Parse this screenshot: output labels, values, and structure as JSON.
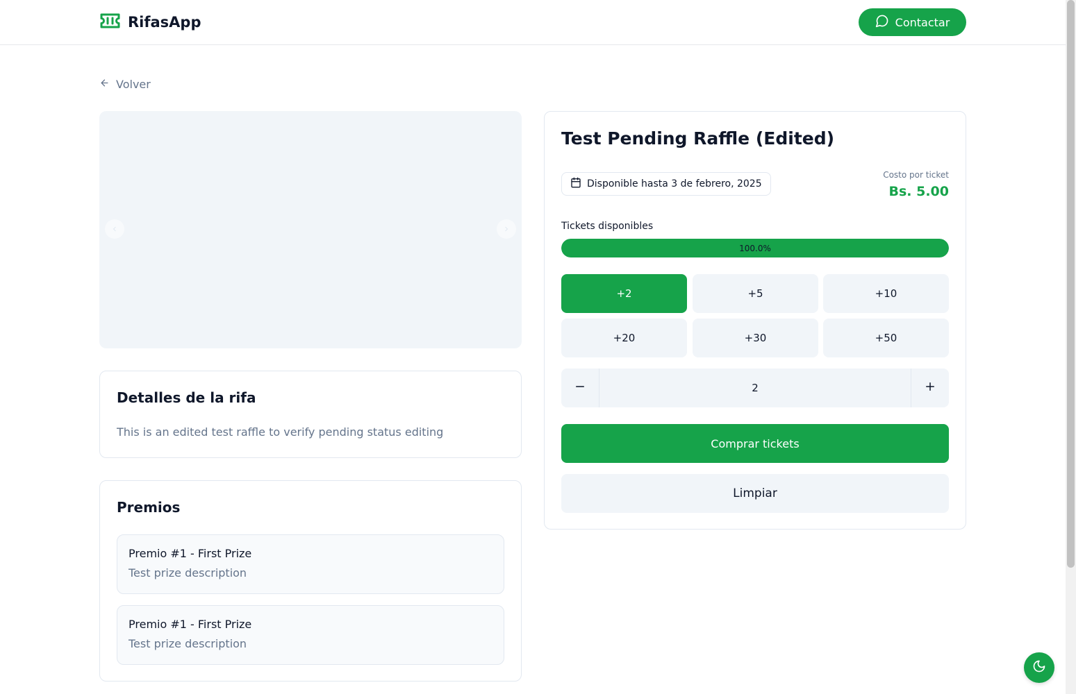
{
  "header": {
    "brand": "RifasApp",
    "brand_icon": "ticket-icon",
    "contact_label": "Contactar",
    "contact_icon": "message-circle-icon",
    "accent_color": "#16a34a"
  },
  "nav": {
    "back_label": "Volver",
    "back_icon": "arrow-left-icon"
  },
  "carousel": {
    "prev_icon": "chevron-left-icon",
    "next_icon": "chevron-right-icon"
  },
  "details": {
    "title": "Detalles de la rifa",
    "description": "This is an edited test raffle to verify pending status editing"
  },
  "prizes": {
    "title": "Premios",
    "items": [
      {
        "name": "Premio #1 - First Prize",
        "description": "Test prize description"
      },
      {
        "name": "Premio #1 - First Prize",
        "description": "Test prize description"
      }
    ]
  },
  "raffle": {
    "title": "Test Pending Raffle (Edited)",
    "available_until": "Disponible hasta 3 de febrero, 2025",
    "calendar_icon": "calendar-icon",
    "cost_label": "Costo por ticket",
    "cost_value": "Bs. 5.00",
    "tickets_label": "Tickets disponibles",
    "progress_text": "100.0%",
    "progress_fraction": 1.0,
    "quick_options": [
      "+2",
      "+5",
      "+10",
      "+20",
      "+30",
      "+50"
    ],
    "selected_option": "+2",
    "quantity": "2",
    "buy_label": "Comprar tickets",
    "clear_label": "Limpiar"
  },
  "theme_toggle": {
    "icon": "moon-icon"
  }
}
